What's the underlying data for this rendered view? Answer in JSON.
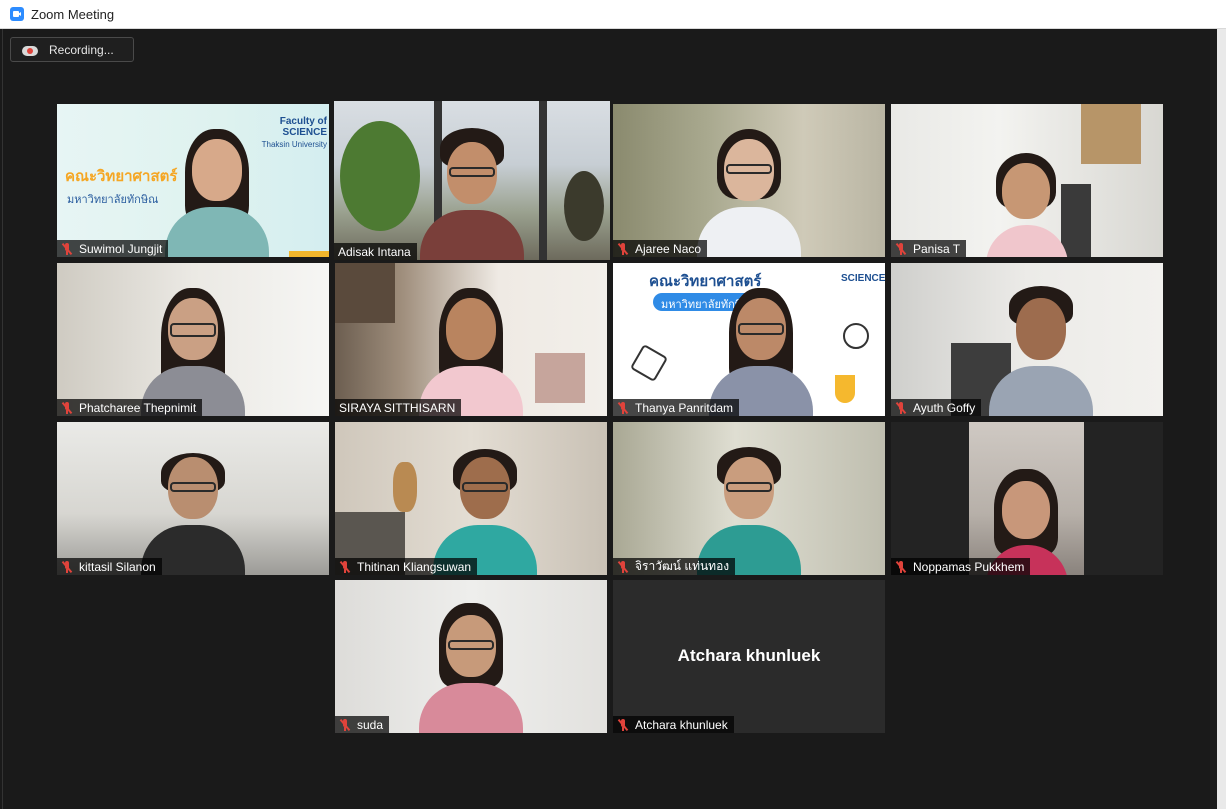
{
  "window": {
    "title": "Zoom Meeting"
  },
  "recording": {
    "label": "Recording..."
  },
  "colors": {
    "active_speaker_border": "#e9e27a",
    "muted_icon": "#e0433b",
    "zoom_blue": "#2d8cff"
  },
  "participants": [
    {
      "name": "Suwimol Jungjit",
      "muted": true
    },
    {
      "name": "Adisak Intana",
      "muted": false,
      "active_speaker": true
    },
    {
      "name": "Ajaree Naco",
      "muted": true
    },
    {
      "name": "Panisa T",
      "muted": true
    },
    {
      "name": "Phatcharee Thepnimit",
      "muted": true
    },
    {
      "name": "SIRAYA SITTHISARN",
      "muted": false
    },
    {
      "name": "Thanya Panritdam",
      "muted": true
    },
    {
      "name": "Ayuth Goffy",
      "muted": true
    },
    {
      "name": "kittasil Silanon",
      "muted": true
    },
    {
      "name": "Thitinan Kliangsuwan",
      "muted": true
    },
    {
      "name": "จิราวัฒน์ แท่นทอง",
      "muted": true
    },
    {
      "name": "Noppamas Pukkhem",
      "muted": true
    },
    {
      "name": "suda",
      "muted": true
    },
    {
      "name": "Atchara khunluek",
      "muted": true,
      "video_off": true
    }
  ],
  "virtual_backgrounds": {
    "banner1_title": "คณะวิทยาศาสตร์",
    "banner1_sub": "มหาวิทยาลัยทักษิณ",
    "banner1_logo": "Faculty of SCIENCE",
    "banner1_univ": "Thaksin University",
    "banner2_title": "คณะวิทยาศาสตร์",
    "banner2_sub": "มหาวิทยาลัยทักษิณ",
    "banner2_logo": "SCIENCE"
  }
}
